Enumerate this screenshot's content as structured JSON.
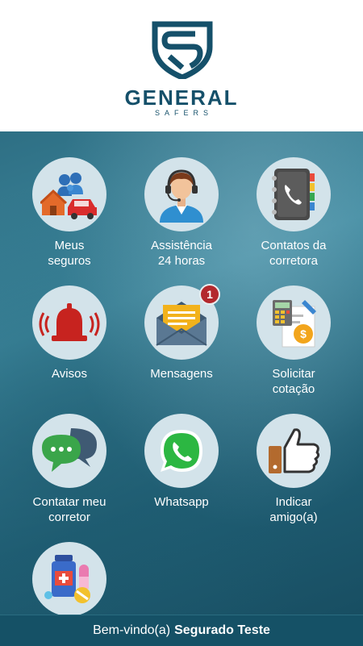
{
  "brand": {
    "name": "GENERAL",
    "subtitle": "SAFERS",
    "color": "#15506a"
  },
  "menu": [
    {
      "label": "Meus\nseguros",
      "icon": "family-house-car-icon"
    },
    {
      "label": "Assistência\n24 horas",
      "icon": "call-center-agent-icon"
    },
    {
      "label": "Contatos da\ncorretora",
      "icon": "phone-book-icon"
    },
    {
      "label": "Avisos",
      "icon": "alarm-bell-icon"
    },
    {
      "label": "Mensagens",
      "icon": "envelope-icon",
      "badge": "1"
    },
    {
      "label": "Solicitar\ncotação",
      "icon": "calculator-document-icon"
    },
    {
      "label": "Contatar meu\ncorretor",
      "icon": "chat-bubbles-icon"
    },
    {
      "label": "Whatsapp",
      "icon": "whatsapp-icon"
    },
    {
      "label": "Indicar\namigo(a)",
      "icon": "thumbs-up-icon"
    },
    {
      "label": "",
      "icon": "medicine-pills-icon"
    }
  ],
  "footer": {
    "greeting": "Bem-vindo(a)",
    "user_name": "Segurado Teste"
  },
  "colors": {
    "badge": "#b3282d",
    "footer": "#155166",
    "circle": "#d3e3ea"
  }
}
